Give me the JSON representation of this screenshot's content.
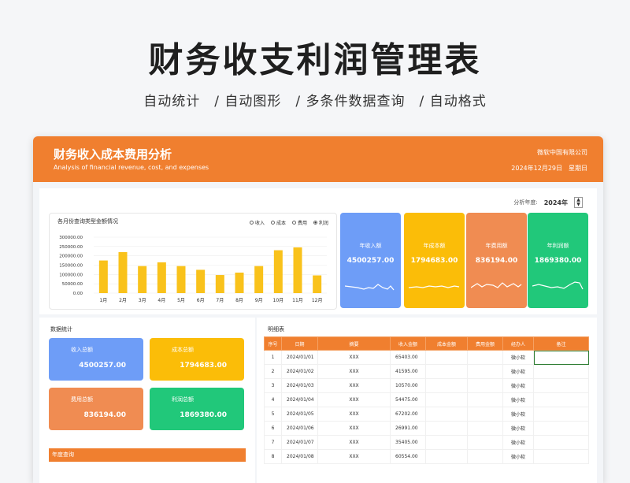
{
  "hero": {
    "title": "财务收支利润管理表",
    "subtitle": "自动统计　/ 自动图形　/ 多条件数据查询　/ 自动格式"
  },
  "banner": {
    "title": "财务收入成本费用分析",
    "subtitle": "Analysis of financial revenue, cost, and expenses",
    "company": "微软中国有限公司",
    "date": "2024年12月29日　星期日"
  },
  "year_selector": {
    "label": "分析年度:",
    "value": "2024年",
    "up": "▲",
    "down": "▼"
  },
  "chart_panel": {
    "title": "各月份查询类型金额情况",
    "legend": [
      "收入",
      "成本",
      "费用",
      "利润"
    ],
    "selected": "利润"
  },
  "chart_data": {
    "type": "bar",
    "title": "各月份查询类型金额情况",
    "categories": [
      "1月",
      "2月",
      "3月",
      "4月",
      "5月",
      "6月",
      "7月",
      "8月",
      "9月",
      "10月",
      "11月",
      "12月"
    ],
    "series": [
      {
        "name": "利润",
        "values": [
          175000,
          220000,
          145000,
          165000,
          145000,
          125000,
          97000,
          110000,
          145000,
          230000,
          245000,
          95000
        ]
      }
    ],
    "yticks": [
      "300000.00",
      "250000.00",
      "200000.00",
      "150000.00",
      "100000.00",
      "50000.00",
      "0.00"
    ],
    "ylim": [
      0,
      300000
    ],
    "grid": true,
    "bar_color": "#f9c21b",
    "legend_position": "top-right"
  },
  "kpis": [
    {
      "label": "年收入额",
      "value": "4500257.00",
      "color": "#6e9df7"
    },
    {
      "label": "年成本额",
      "value": "1794683.00",
      "color": "#fbbd08"
    },
    {
      "label": "年费用额",
      "value": "836194.00",
      "color": "#f08c52"
    },
    {
      "label": "年利润额",
      "value": "1869380.00",
      "color": "#21c87a"
    }
  ],
  "stats": {
    "title": "数据统计",
    "cards": [
      {
        "label": "收入总额",
        "value": "4500257.00",
        "color": "#6e9df7"
      },
      {
        "label": "成本总额",
        "value": "1794683.00",
        "color": "#fbbd08"
      },
      {
        "label": "费用总额",
        "value": "836194.00",
        "color": "#f08c52"
      },
      {
        "label": "利润总额",
        "value": "1869380.00",
        "color": "#21c87a"
      }
    ],
    "query_label": "年度查询"
  },
  "detail": {
    "title": "明细表",
    "headers": [
      "序号",
      "日期",
      "摘要",
      "收入金额",
      "成本金额",
      "费用金额",
      "经办人",
      "备注"
    ],
    "rows": [
      [
        "1",
        "2024/01/01",
        "XXX",
        "65403.00",
        "",
        "",
        "微小软",
        ""
      ],
      [
        "2",
        "2024/01/02",
        "XXX",
        "41595.00",
        "",
        "",
        "微小软",
        ""
      ],
      [
        "3",
        "2024/01/03",
        "XXX",
        "10570.00",
        "",
        "",
        "微小软",
        ""
      ],
      [
        "4",
        "2024/01/04",
        "XXX",
        "54475.00",
        "",
        "",
        "微小软",
        ""
      ],
      [
        "5",
        "2024/01/05",
        "XXX",
        "67202.00",
        "",
        "",
        "微小软",
        ""
      ],
      [
        "6",
        "2024/01/06",
        "XXX",
        "26991.00",
        "",
        "",
        "微小软",
        ""
      ],
      [
        "7",
        "2024/01/07",
        "XXX",
        "35405.00",
        "",
        "",
        "微小软",
        ""
      ],
      [
        "8",
        "2024/01/08",
        "XXX",
        "60554.00",
        "",
        "",
        "微小软",
        ""
      ]
    ]
  }
}
